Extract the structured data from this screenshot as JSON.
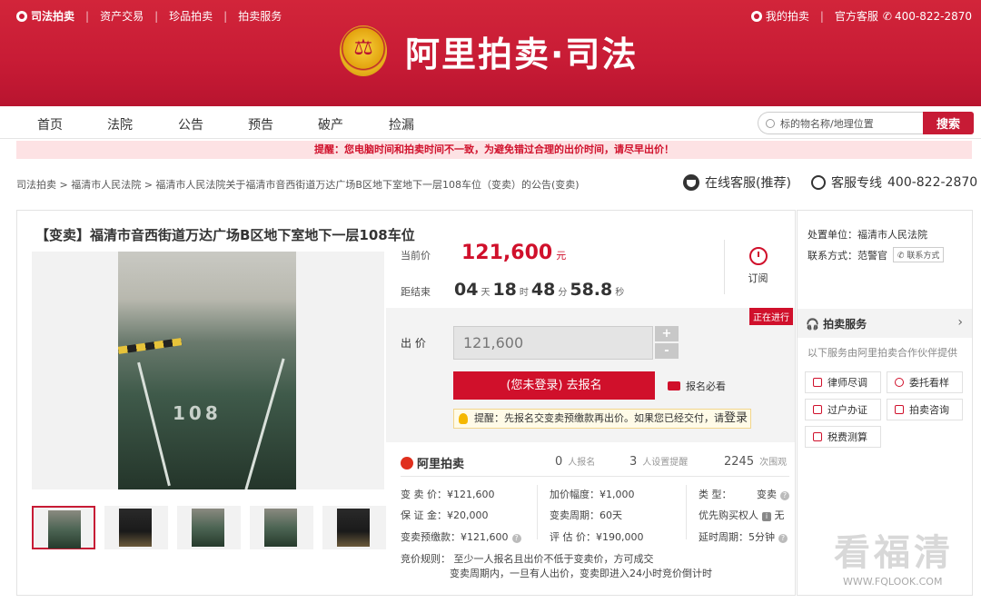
{
  "topbar": {
    "brand": "司法拍卖",
    "links": [
      "资产交易",
      "珍品拍卖",
      "拍卖服务"
    ],
    "my_auction": "我的拍卖",
    "service": "官方客服",
    "phone": "400-822-2870"
  },
  "logo": {
    "text": "阿里拍卖·司法"
  },
  "nav": {
    "items": [
      "首页",
      "法院",
      "公告",
      "预告",
      "破产",
      "捡漏"
    ],
    "search_placeholder": "标的物名称/地理位置",
    "search_button": "搜索"
  },
  "alert": "提醒：您电脑时间和拍卖时间不一致，为避免错过合理的出价时间，请尽早出价！",
  "breadcrumb": "司法拍卖 > 福清市人民法院 > 福清市人民法院关于福清市音西街道万达广场B区地下室地下一层108车位（变卖）的公告(变卖)",
  "service": {
    "online": "在线客服(推荐)",
    "hotline_label": "客服专线",
    "hotline": "400-822-2870"
  },
  "item": {
    "title": "【变卖】福清市音西街道万达广场B区地下室地下一层108车位",
    "photo_text": "108",
    "price_label": "当前价",
    "price": "121,600",
    "price_unit": "元",
    "countdown_label": "距结束",
    "countdown": {
      "days": "04",
      "hours": "18",
      "minutes": "48",
      "seconds": "58.8"
    },
    "countdown_units": {
      "d": "天",
      "h": "时",
      "m": "分",
      "s": "秒"
    },
    "subscribe": "订阅",
    "status": "正在进行",
    "bid_label": "出  价",
    "bid_value": "121,600",
    "plus": "+",
    "minus": "-",
    "register_button": "(您未登录) 去报名",
    "must_read": "报名必看",
    "tip": "提醒：先报名交变卖预缴款再出价。如果您已经交付，请",
    "tip_link": "登录"
  },
  "stats": {
    "brand": "阿里拍卖",
    "signups": "0",
    "signups_label": "人报名",
    "reminders": "3",
    "reminders_label": "人设置提醒",
    "views": "2245",
    "views_label": "次围观"
  },
  "details": {
    "sell_price": "变 卖 价：¥121,600",
    "deposit": "保 证 金：¥20,000",
    "prepay": "变卖预缴款：¥121,600",
    "increment": "加价幅度：¥1,000",
    "period": "变卖周期：60天",
    "appraisal": "评 估 价：¥190,000",
    "type": "类    型：",
    "type_value": "变卖",
    "priority": "优先购买权人",
    "priority_value": "无",
    "delay": "延时周期：5分钟",
    "rule_1": "竞价规则：  至少一人报名且出价不低于变卖价，方可成交",
    "rule_2": "变卖周期内，一旦有人出价，变卖即进入24小时竞价倒计时"
  },
  "sidebar": {
    "org_label": "处置单位：",
    "org": "福清市人民法院",
    "contact_label": "联系方式：范警官",
    "contact_button": "联系方式",
    "service_title": "拍卖服务",
    "service_sub": "以下服务由阿里拍卖合作伙伴提供",
    "buttons": [
      "律师尽调",
      "委托看样",
      "过户办证",
      "拍卖咨询",
      "税费测算"
    ]
  },
  "watermark": {
    "big": "看福清",
    "small": "WWW.FQLOOK.COM"
  }
}
